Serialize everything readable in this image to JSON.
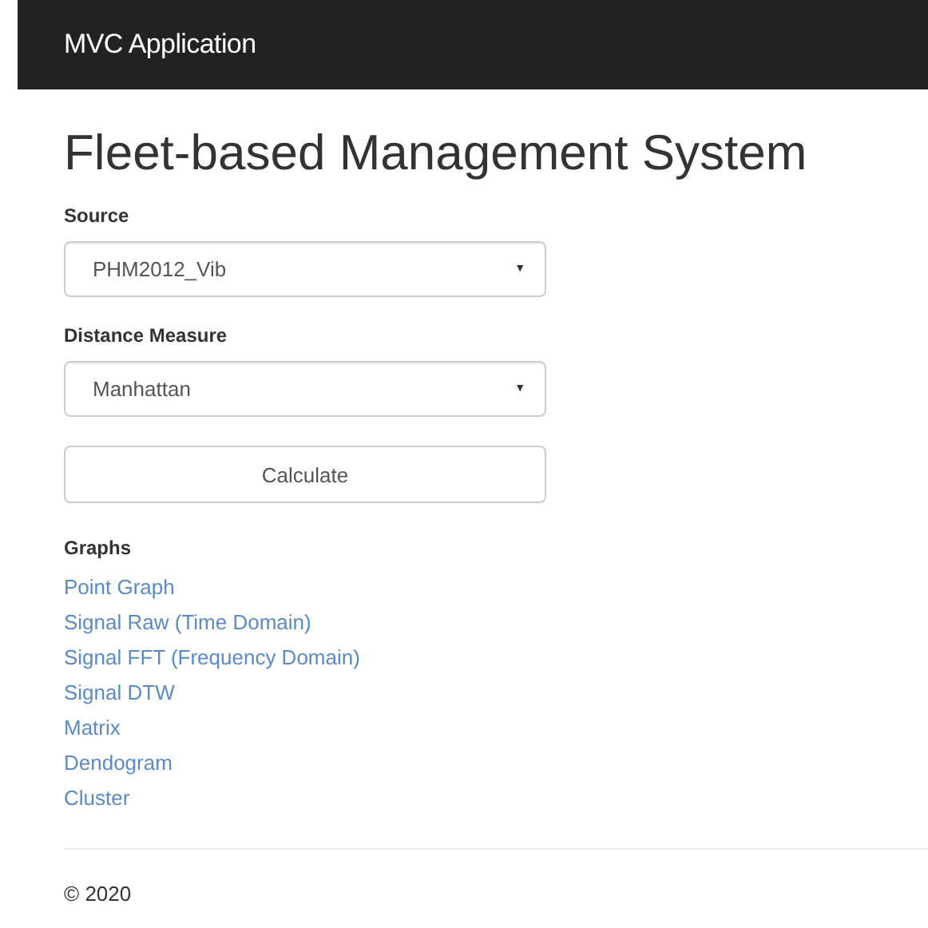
{
  "navbar": {
    "brand": "MVC Application"
  },
  "title": "Fleet-based Management System",
  "fields": [
    {
      "label": "Source",
      "value": "PHM2012_Vib",
      "caret": "▼"
    },
    {
      "label": "Distance Measure",
      "value": "Manhattan",
      "caret": "▼"
    }
  ],
  "button": "Calculate",
  "graphs": {
    "heading": "Graphs",
    "links": [
      "Point Graph",
      "Signal Raw (Time Domain)",
      "Signal FFT (Frequency Domain)",
      "Signal DTW",
      "Matrix",
      "Dendogram",
      "Cluster"
    ]
  },
  "footer": "© 2020"
}
